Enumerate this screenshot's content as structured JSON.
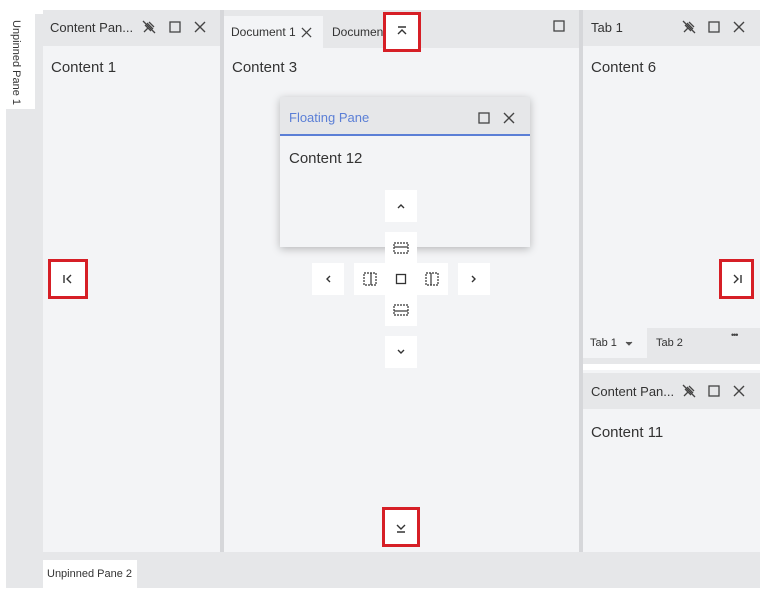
{
  "left_strip": {
    "unpinned_tab": "Unpinned Pane 1"
  },
  "bottom_strip": {
    "unpinned_tab": "Unpinned Pane 2"
  },
  "left_pane": {
    "title": "Content Pan...",
    "content": "Content 1"
  },
  "documents": {
    "tabs": [
      {
        "label": "Document 1"
      },
      {
        "label": "Documen"
      }
    ],
    "content": "Content 3"
  },
  "floating": {
    "title": "Floating Pane",
    "content": "Content 12"
  },
  "right_top": {
    "title": "Tab 1",
    "content": "Content 6"
  },
  "right_tabs": {
    "tabs": [
      {
        "label": "Tab 1"
      },
      {
        "label": "Tab 2"
      }
    ],
    "more": "•••"
  },
  "right_bottom": {
    "title": "Content Pan...",
    "content": "Content 11"
  },
  "colors": {
    "accent": "#5b7fd6",
    "highlight": "#d61f26",
    "panel": "#f3f4f6",
    "bar": "#e6e7e9"
  }
}
